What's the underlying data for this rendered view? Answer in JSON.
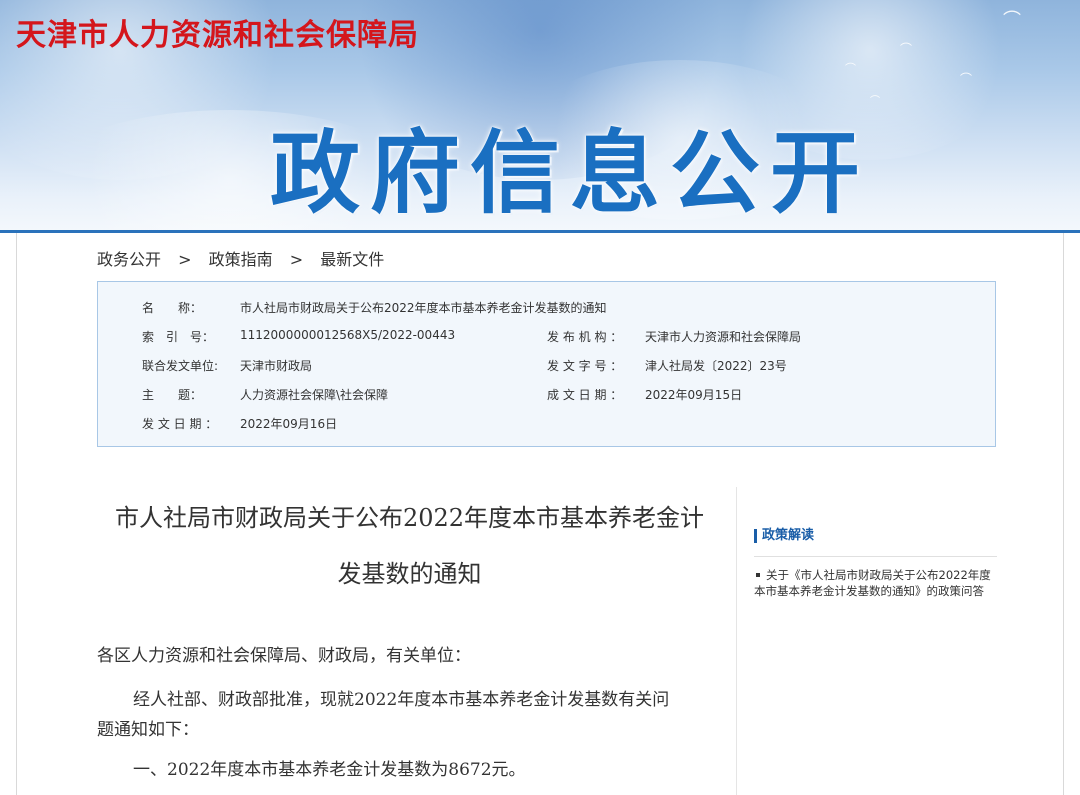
{
  "header": {
    "org_name": "天津市人力资源和社会保障局",
    "section": "政府信息公开"
  },
  "breadcrumb": [
    "政务公开",
    "政策指南",
    "最新文件"
  ],
  "breadcrumb_separator": ">",
  "info": {
    "name_label": "名　　称：",
    "name_value": "市人社局市财政局关于公布2022年度本市基本养老金计发基数的通知",
    "index_label": "索　引　号：",
    "index_value": "1112000000012568X5/2022-00443",
    "issuer_label": "发 布 机 构 ：",
    "issuer_value": "天津市人力资源和社会保障局",
    "joint_label": "联合发文单位:",
    "joint_value": "天津市财政局",
    "docno_label": "发 文 字 号 ：",
    "docno_value": "津人社局发〔2022〕23号",
    "subject_label": "主　　题：",
    "subject_value": "人力资源社会保障\\社会保障",
    "created_label": "成 文 日 期 ：",
    "created_value": "2022年09月15日",
    "issued_label": "发 文 日 期 ：",
    "issued_value": "2022年09月16日"
  },
  "article": {
    "title_line1": "市人社局市财政局关于公布2022年度本市基本养老金计",
    "title_line2": "发基数的通知",
    "salutation": "各区人力资源和社会保障局、财政局，有关单位：",
    "para1_line1": "经人社部、财政部批准，现就2022年度本市基本养老金计发基数有关问",
    "para1_line2": "题通知如下：",
    "para2": "一、2022年度本市基本养老金计发基数为8672元。"
  },
  "sidebar": {
    "heading": "政策解读",
    "link": "关于《市人社局市财政局关于公布2022年度本市基本养老金计发基数的通知》的政策问答"
  },
  "colors": {
    "org_red": "#d4161c",
    "section_blue": "#1a6fc1",
    "accent_blue": "#2a72bb"
  }
}
